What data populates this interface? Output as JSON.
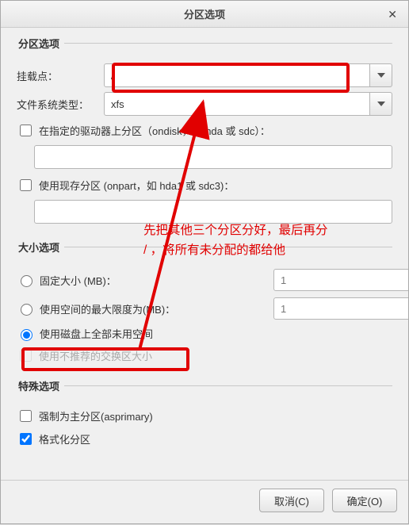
{
  "window": {
    "title": "分区选项"
  },
  "section_partition": {
    "legend": "分区选项",
    "mount_label": "挂载点：",
    "mount_value": "/",
    "fstype_label": "文件系统类型：",
    "fstype_value": "xfs",
    "ondisk_label": "在指定的驱动器上分区（ondisk，如 hda 或 sdc）：",
    "ondisk_value": "",
    "onpart_label": "使用现存分区 (onpart，如 hda1 或 sdc3)：",
    "onpart_value": ""
  },
  "section_size": {
    "legend": "大小选项",
    "fixed_label": "固定大小 (MB)：",
    "fixed_value": "1",
    "maxsize_label": "使用空间的最大限度为(MB)：",
    "maxsize_value": "1",
    "grow_label": "使用磁盘上全部未用空间",
    "recommended_label": "使用不推荐的交换区大小"
  },
  "section_special": {
    "legend": "特殊选项",
    "asprimary_label": "强制为主分区(asprimary)",
    "format_label": "格式化分区"
  },
  "footer": {
    "cancel": "取消(C)",
    "ok": "确定(O)"
  },
  "annotation": {
    "line1": "先把其他三个分区分好，最后再分",
    "line2": "/ ，将所有未分配的都给他"
  }
}
